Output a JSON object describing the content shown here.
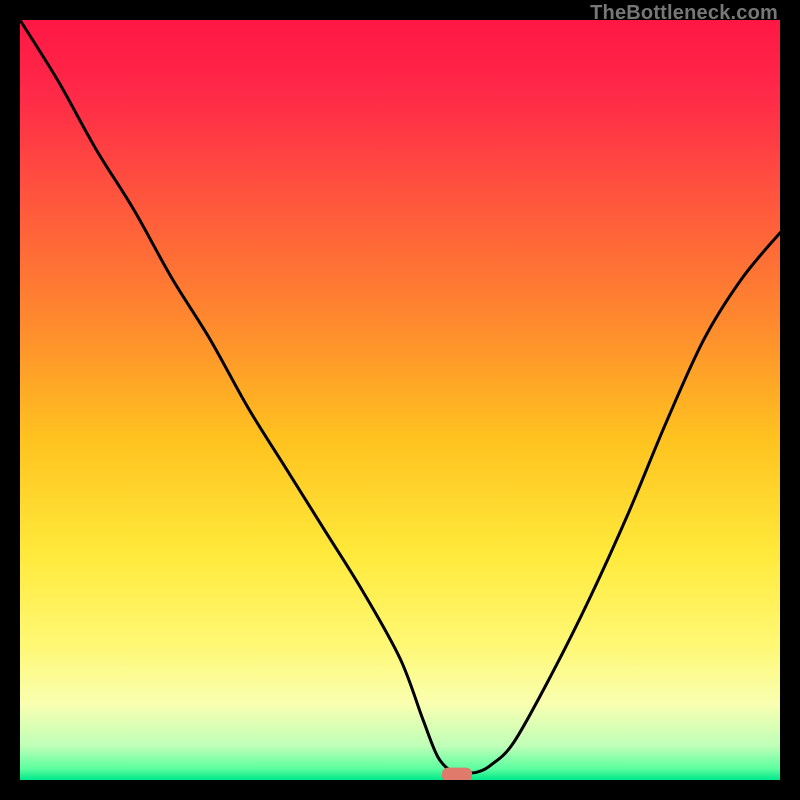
{
  "watermark": "TheBottleneck.com",
  "chart_data": {
    "type": "line",
    "title": "",
    "xlabel": "",
    "ylabel": "",
    "xlim": [
      0,
      100
    ],
    "ylim": [
      0,
      100
    ],
    "grid": false,
    "legend": null,
    "series": [
      {
        "name": "bottleneck-curve",
        "x": [
          0,
          5,
          10,
          15,
          20,
          25,
          30,
          35,
          40,
          45,
          50,
          53,
          55,
          57,
          58,
          60,
          62,
          65,
          70,
          75,
          80,
          85,
          90,
          95,
          100
        ],
        "y": [
          100,
          92,
          83,
          75,
          66,
          58,
          49,
          41,
          33,
          25,
          16,
          8,
          3,
          1,
          1,
          1,
          2,
          5,
          14,
          24,
          35,
          47,
          58,
          66,
          72
        ]
      }
    ],
    "marker": {
      "x": 57.5,
      "y": 0.7,
      "shape": "rounded-rect",
      "color": "#e07a6a"
    },
    "background_gradient": {
      "stops": [
        {
          "pos": 0.0,
          "color": "#ff1744"
        },
        {
          "pos": 0.1,
          "color": "#ff2a48"
        },
        {
          "pos": 0.25,
          "color": "#ff5a3c"
        },
        {
          "pos": 0.4,
          "color": "#ff8a2e"
        },
        {
          "pos": 0.55,
          "color": "#ffc21f"
        },
        {
          "pos": 0.7,
          "color": "#ffe93a"
        },
        {
          "pos": 0.82,
          "color": "#fff873"
        },
        {
          "pos": 0.9,
          "color": "#f9ffb0"
        },
        {
          "pos": 0.955,
          "color": "#bfffb8"
        },
        {
          "pos": 0.985,
          "color": "#5dffa0"
        },
        {
          "pos": 1.0,
          "color": "#00e88a"
        }
      ]
    },
    "colors": {
      "curve": "#000000",
      "frame": "#000000",
      "marker_fill": "#e07a6a"
    }
  }
}
